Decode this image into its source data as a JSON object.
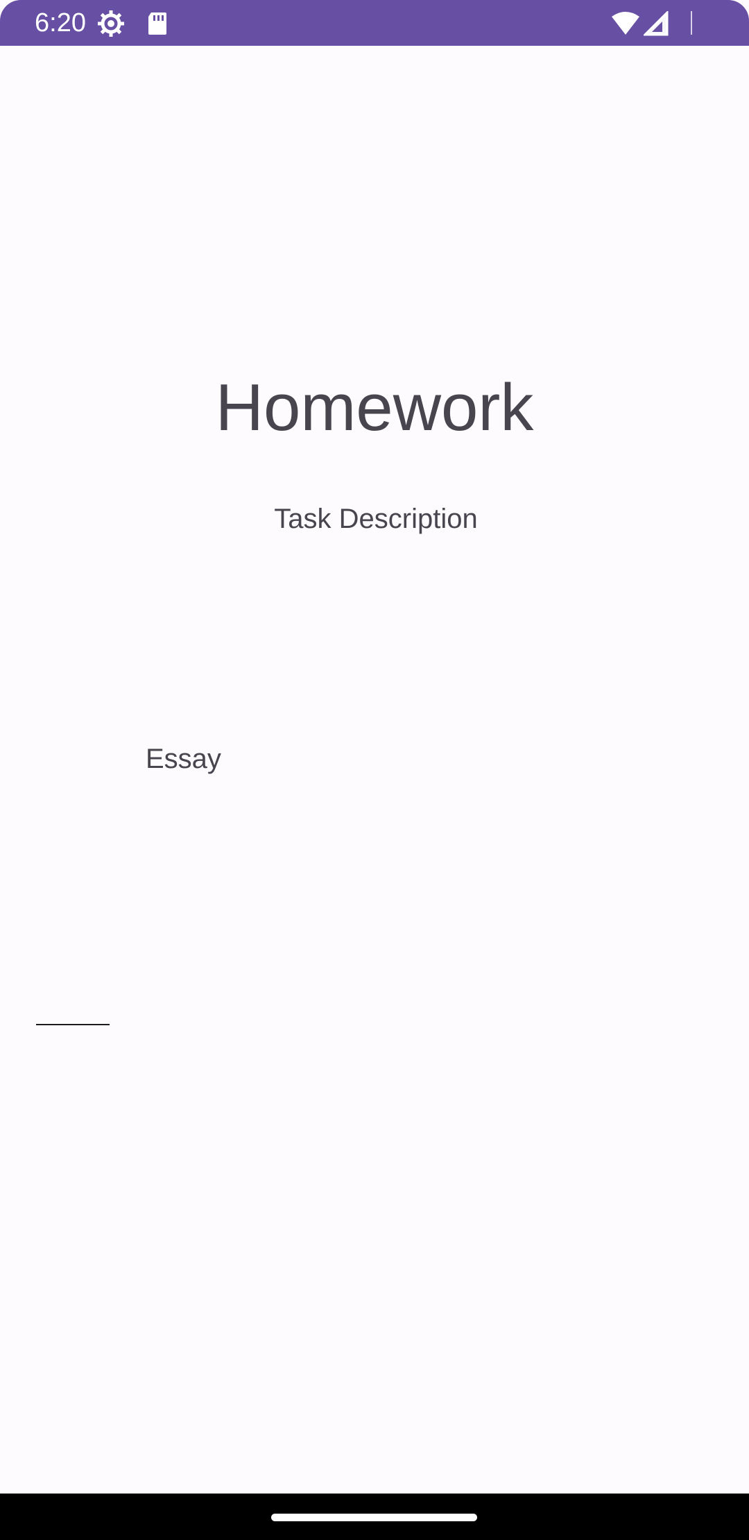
{
  "status_bar": {
    "time": "6:20",
    "background_color": "#6750a4",
    "icons": [
      "gear-icon",
      "sd-card-icon",
      "wifi-icon",
      "signal-icon"
    ]
  },
  "main": {
    "title": "Homework",
    "subtitle": "Task Description",
    "essay_label": "Essay",
    "input": {
      "value": "",
      "placeholder": ""
    }
  },
  "colors": {
    "text": "#49454f",
    "background": "#fefbff"
  }
}
